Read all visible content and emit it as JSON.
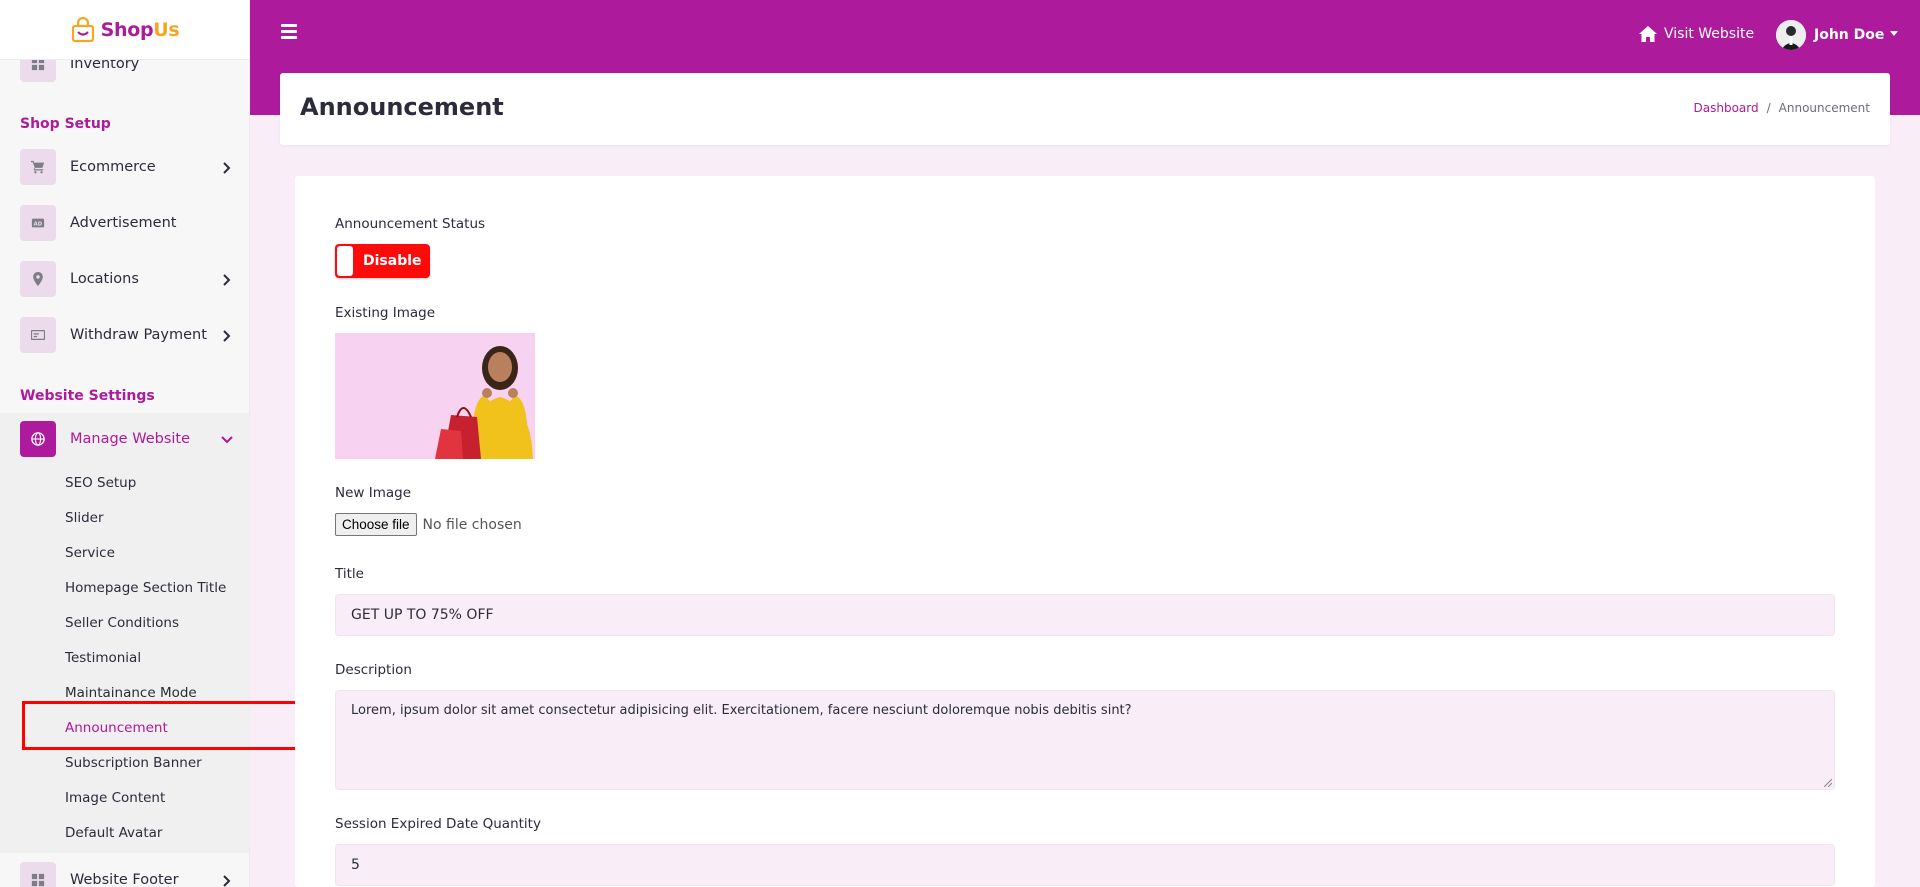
{
  "brand": {
    "name_main": "Shop",
    "name_accent": "Us"
  },
  "sidebar": {
    "top_partial_item": "Inventory",
    "shop_setup_title": "Shop Setup",
    "shop_setup_items": [
      {
        "label": "Ecommerce",
        "icon": "cart-icon",
        "has_children": true
      },
      {
        "label": "Advertisement",
        "icon": "ad-icon",
        "has_children": false
      },
      {
        "label": "Locations",
        "icon": "map-pin-icon",
        "has_children": true
      },
      {
        "label": "Withdraw Payment",
        "icon": "money-icon",
        "has_children": true
      }
    ],
    "website_settings_title": "Website Settings",
    "manage_website": {
      "label": "Manage Website",
      "icon": "globe-icon",
      "expanded": true
    },
    "manage_website_subitems": [
      "SEO Setup",
      "Slider",
      "Service",
      "Homepage Section Title",
      "Seller Conditions",
      "Testimonial",
      "Maintainance Mode",
      "Announcement",
      "Subscription Banner",
      "Image Content",
      "Default Avatar"
    ],
    "active_subitem": "Announcement",
    "bottom_item": {
      "label": "Website Footer",
      "icon": "grid-icon",
      "has_children": true
    }
  },
  "topbar": {
    "visit_website_label": "Visit Website",
    "user_name": "John Doe",
    "accent_color": "#ad1a9c"
  },
  "header": {
    "title": "Announcement",
    "breadcrumb": {
      "home": "Dashboard",
      "current": "Announcement",
      "separator": "/"
    }
  },
  "form": {
    "status_label": "Announcement Status",
    "status_toggle_text": "Disable",
    "status_color": "#ff0a0a",
    "existing_image_label": "Existing Image",
    "new_image_label": "New Image",
    "file_button_label": "Choose file",
    "file_status": "No file chosen",
    "title_label": "Title",
    "title_value": "GET UP TO 75% OFF",
    "description_label": "Description",
    "description_value": "Lorem, ipsum dolor sit amet consectetur adipisicing elit. Exercitationem, facere nesciunt doloremque nobis debitis sint?",
    "session_label": "Session Expired Date Quantity",
    "session_value": "5"
  }
}
